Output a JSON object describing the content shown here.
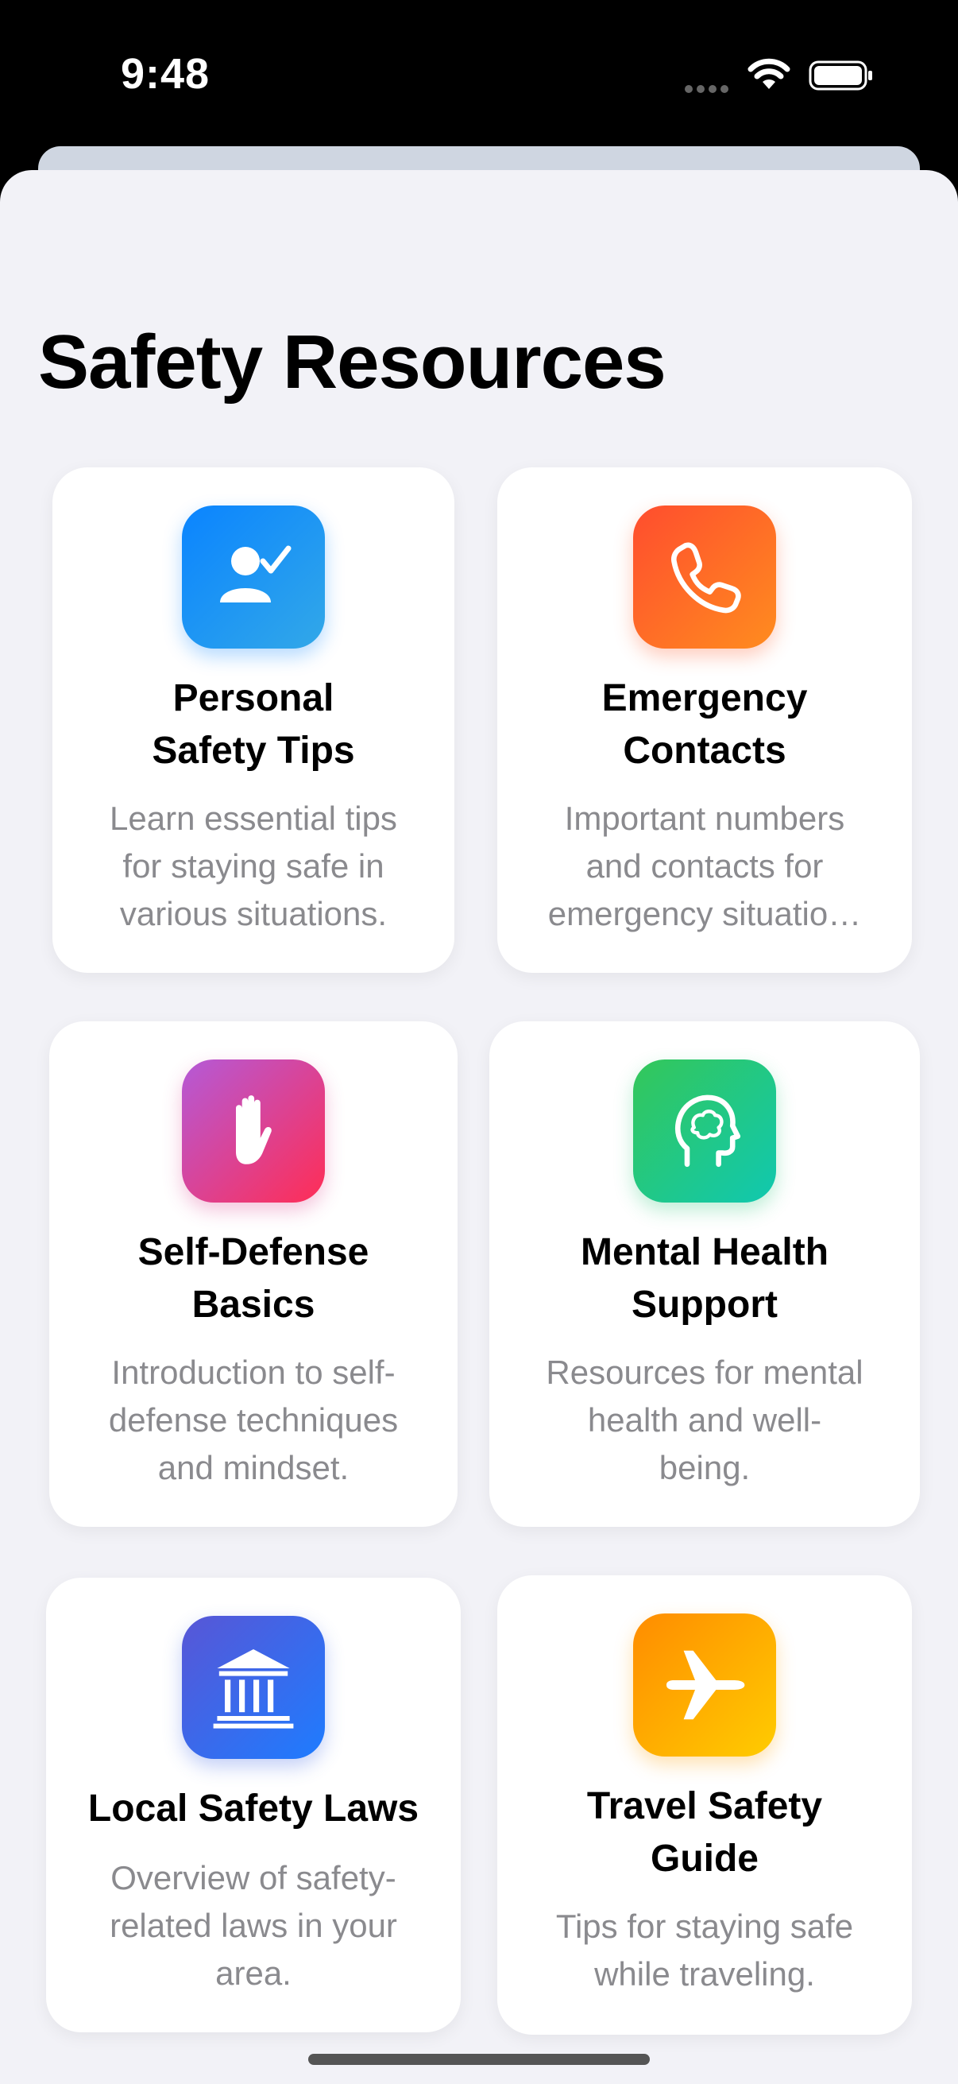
{
  "status_bar": {
    "time": "9:48",
    "icons": [
      "cellular-dots-icon",
      "wifi-icon",
      "battery-icon"
    ]
  },
  "page": {
    "title": "Safety Resources"
  },
  "cards": [
    {
      "title": "Personal\nSafety Tips",
      "description": "Learn essential tips\nfor staying safe in\nvarious situations.",
      "icon": "person-check-icon",
      "colors": [
        "#0a84ff",
        "#32a0e6"
      ]
    },
    {
      "title": "Emergency\nContacts",
      "description": "Important numbers\nand contacts for\nemergency situatio…",
      "icon": "phone-icon",
      "colors": [
        "#ff4d2e",
        "#ff8a1f"
      ]
    },
    {
      "title": "Self-Defense\nBasics",
      "description": "Introduction to self-\ndefense techniques\nand mindset.",
      "icon": "raised-hand-icon",
      "colors": [
        "#b85cd6",
        "#ff2d55"
      ]
    },
    {
      "title": "Mental Health\nSupport",
      "description": "Resources for mental\nhealth and well-\nbeing.",
      "icon": "brain-head-icon",
      "colors": [
        "#34c759",
        "#10c8b0"
      ]
    },
    {
      "title": "Local Safety Laws",
      "description": "Overview of safety-\nrelated laws in your\narea.",
      "icon": "building-columns-icon",
      "colors": [
        "#5856d6",
        "#1e7cff"
      ]
    },
    {
      "title": "Travel Safety\nGuide",
      "description": "Tips for staying safe\nwhile traveling.",
      "icon": "airplane-icon",
      "colors": [
        "#ff8c00",
        "#ffcc00"
      ]
    }
  ]
}
